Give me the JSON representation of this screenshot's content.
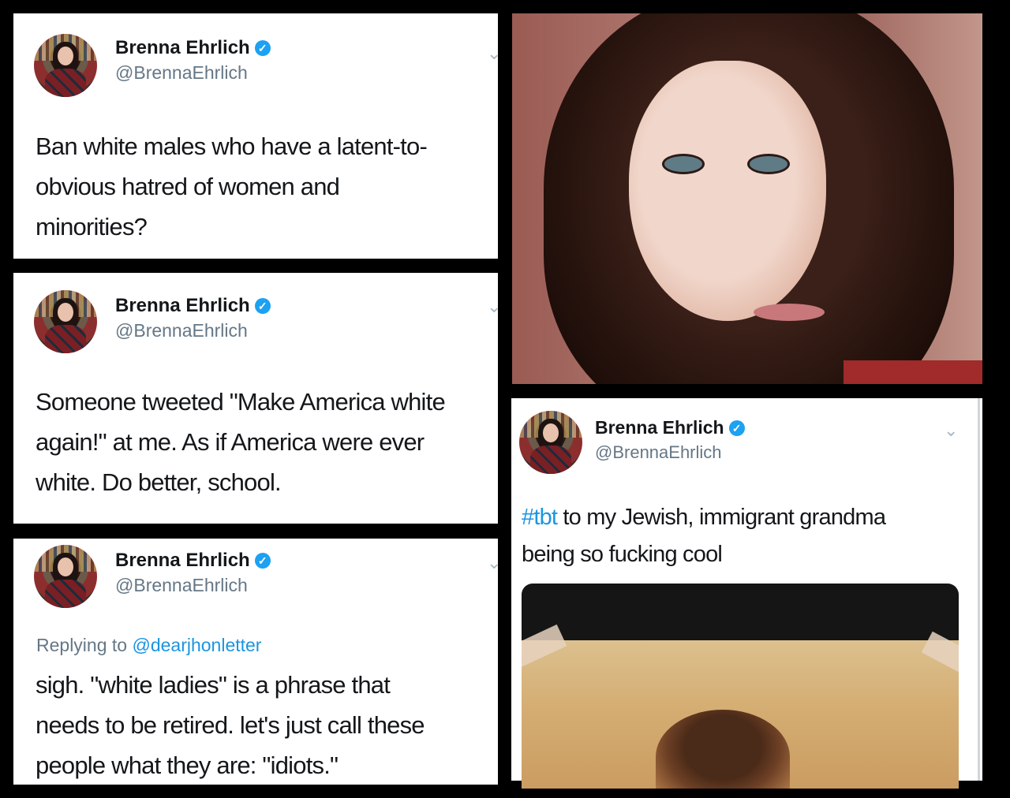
{
  "tweets": [
    {
      "name": "Brenna Ehrlich",
      "handle": "@BrennaEhrlich",
      "lines": [
        "Ban white males who have a latent-to-",
        "obvious hatred of women and",
        "minorities?"
      ]
    },
    {
      "name": "Brenna Ehrlich",
      "handle": "@BrennaEhrlich",
      "lines": [
        "Someone tweeted \"Make America white",
        "again!\" at me. As if America were ever",
        "white. Do better, school."
      ]
    },
    {
      "name": "Brenna Ehrlich",
      "handle": "@BrennaEhrlich",
      "reply_prefix": "Replying to",
      "reply_to": "@dearjhonletter",
      "lines": [
        "sigh. \"white ladies\" is a phrase that",
        "needs to be retired. let's just call these",
        "people what they are: \"idiots.\""
      ]
    },
    {
      "name": "Brenna Ehrlich",
      "handle": "@BrennaEhrlich",
      "hashtag": "#tbt",
      "line1_rest": " to my Jewish, immigrant grandma",
      "line2": "being so fucking cool"
    }
  ],
  "icons": {
    "verified": "verified-badge-icon",
    "chevron": "chevron-down-icon"
  },
  "colors": {
    "link": "#1b95e0",
    "verified": "#1da1f2",
    "background": "#000000"
  }
}
